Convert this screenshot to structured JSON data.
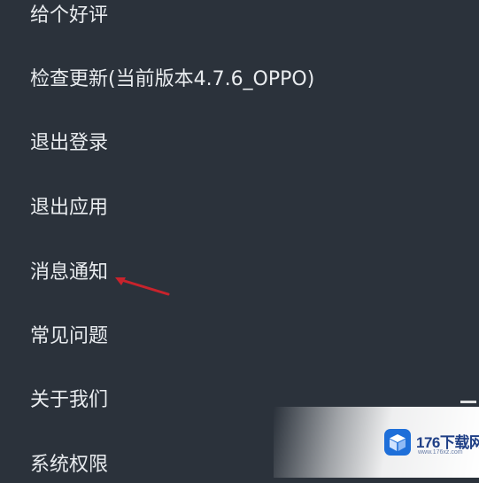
{
  "menu": {
    "items": [
      {
        "label": "给个好评"
      },
      {
        "label": "检查更新(当前版本4.7.6_OPPO)"
      },
      {
        "label": "退出登录"
      },
      {
        "label": "退出应用"
      },
      {
        "label": "消息通知"
      },
      {
        "label": "常见问题"
      },
      {
        "label": "关于我们"
      },
      {
        "label": "系统权限"
      }
    ]
  },
  "annotation": {
    "arrow_color": "#c8232c",
    "points_to": "消息通知"
  },
  "watermark": {
    "name": "176下载网",
    "url": "www.176xz.com",
    "icon": "cube-logo-icon"
  },
  "colors": {
    "background": "#2b323b",
    "text": "#e9ecef",
    "watermark_blue": "#1f3f86"
  }
}
